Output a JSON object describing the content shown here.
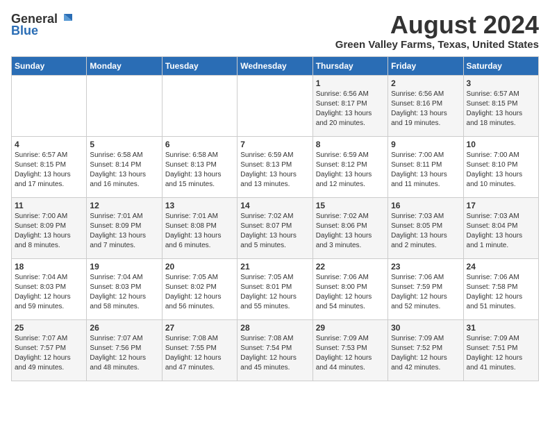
{
  "header": {
    "logo_line1": "General",
    "logo_line2": "Blue",
    "month_title": "August 2024",
    "location": "Green Valley Farms, Texas, United States"
  },
  "days_of_week": [
    "Sunday",
    "Monday",
    "Tuesday",
    "Wednesday",
    "Thursday",
    "Friday",
    "Saturday"
  ],
  "weeks": [
    [
      {
        "day": "",
        "info": ""
      },
      {
        "day": "",
        "info": ""
      },
      {
        "day": "",
        "info": ""
      },
      {
        "day": "",
        "info": ""
      },
      {
        "day": "1",
        "info": "Sunrise: 6:56 AM\nSunset: 8:17 PM\nDaylight: 13 hours\nand 20 minutes."
      },
      {
        "day": "2",
        "info": "Sunrise: 6:56 AM\nSunset: 8:16 PM\nDaylight: 13 hours\nand 19 minutes."
      },
      {
        "day": "3",
        "info": "Sunrise: 6:57 AM\nSunset: 8:15 PM\nDaylight: 13 hours\nand 18 minutes."
      }
    ],
    [
      {
        "day": "4",
        "info": "Sunrise: 6:57 AM\nSunset: 8:15 PM\nDaylight: 13 hours\nand 17 minutes."
      },
      {
        "day": "5",
        "info": "Sunrise: 6:58 AM\nSunset: 8:14 PM\nDaylight: 13 hours\nand 16 minutes."
      },
      {
        "day": "6",
        "info": "Sunrise: 6:58 AM\nSunset: 8:13 PM\nDaylight: 13 hours\nand 15 minutes."
      },
      {
        "day": "7",
        "info": "Sunrise: 6:59 AM\nSunset: 8:13 PM\nDaylight: 13 hours\nand 13 minutes."
      },
      {
        "day": "8",
        "info": "Sunrise: 6:59 AM\nSunset: 8:12 PM\nDaylight: 13 hours\nand 12 minutes."
      },
      {
        "day": "9",
        "info": "Sunrise: 7:00 AM\nSunset: 8:11 PM\nDaylight: 13 hours\nand 11 minutes."
      },
      {
        "day": "10",
        "info": "Sunrise: 7:00 AM\nSunset: 8:10 PM\nDaylight: 13 hours\nand 10 minutes."
      }
    ],
    [
      {
        "day": "11",
        "info": "Sunrise: 7:00 AM\nSunset: 8:09 PM\nDaylight: 13 hours\nand 8 minutes."
      },
      {
        "day": "12",
        "info": "Sunrise: 7:01 AM\nSunset: 8:09 PM\nDaylight: 13 hours\nand 7 minutes."
      },
      {
        "day": "13",
        "info": "Sunrise: 7:01 AM\nSunset: 8:08 PM\nDaylight: 13 hours\nand 6 minutes."
      },
      {
        "day": "14",
        "info": "Sunrise: 7:02 AM\nSunset: 8:07 PM\nDaylight: 13 hours\nand 5 minutes."
      },
      {
        "day": "15",
        "info": "Sunrise: 7:02 AM\nSunset: 8:06 PM\nDaylight: 13 hours\nand 3 minutes."
      },
      {
        "day": "16",
        "info": "Sunrise: 7:03 AM\nSunset: 8:05 PM\nDaylight: 13 hours\nand 2 minutes."
      },
      {
        "day": "17",
        "info": "Sunrise: 7:03 AM\nSunset: 8:04 PM\nDaylight: 13 hours\nand 1 minute."
      }
    ],
    [
      {
        "day": "18",
        "info": "Sunrise: 7:04 AM\nSunset: 8:03 PM\nDaylight: 12 hours\nand 59 minutes."
      },
      {
        "day": "19",
        "info": "Sunrise: 7:04 AM\nSunset: 8:03 PM\nDaylight: 12 hours\nand 58 minutes."
      },
      {
        "day": "20",
        "info": "Sunrise: 7:05 AM\nSunset: 8:02 PM\nDaylight: 12 hours\nand 56 minutes."
      },
      {
        "day": "21",
        "info": "Sunrise: 7:05 AM\nSunset: 8:01 PM\nDaylight: 12 hours\nand 55 minutes."
      },
      {
        "day": "22",
        "info": "Sunrise: 7:06 AM\nSunset: 8:00 PM\nDaylight: 12 hours\nand 54 minutes."
      },
      {
        "day": "23",
        "info": "Sunrise: 7:06 AM\nSunset: 7:59 PM\nDaylight: 12 hours\nand 52 minutes."
      },
      {
        "day": "24",
        "info": "Sunrise: 7:06 AM\nSunset: 7:58 PM\nDaylight: 12 hours\nand 51 minutes."
      }
    ],
    [
      {
        "day": "25",
        "info": "Sunrise: 7:07 AM\nSunset: 7:57 PM\nDaylight: 12 hours\nand 49 minutes."
      },
      {
        "day": "26",
        "info": "Sunrise: 7:07 AM\nSunset: 7:56 PM\nDaylight: 12 hours\nand 48 minutes."
      },
      {
        "day": "27",
        "info": "Sunrise: 7:08 AM\nSunset: 7:55 PM\nDaylight: 12 hours\nand 47 minutes."
      },
      {
        "day": "28",
        "info": "Sunrise: 7:08 AM\nSunset: 7:54 PM\nDaylight: 12 hours\nand 45 minutes."
      },
      {
        "day": "29",
        "info": "Sunrise: 7:09 AM\nSunset: 7:53 PM\nDaylight: 12 hours\nand 44 minutes."
      },
      {
        "day": "30",
        "info": "Sunrise: 7:09 AM\nSunset: 7:52 PM\nDaylight: 12 hours\nand 42 minutes."
      },
      {
        "day": "31",
        "info": "Sunrise: 7:09 AM\nSunset: 7:51 PM\nDaylight: 12 hours\nand 41 minutes."
      }
    ]
  ]
}
